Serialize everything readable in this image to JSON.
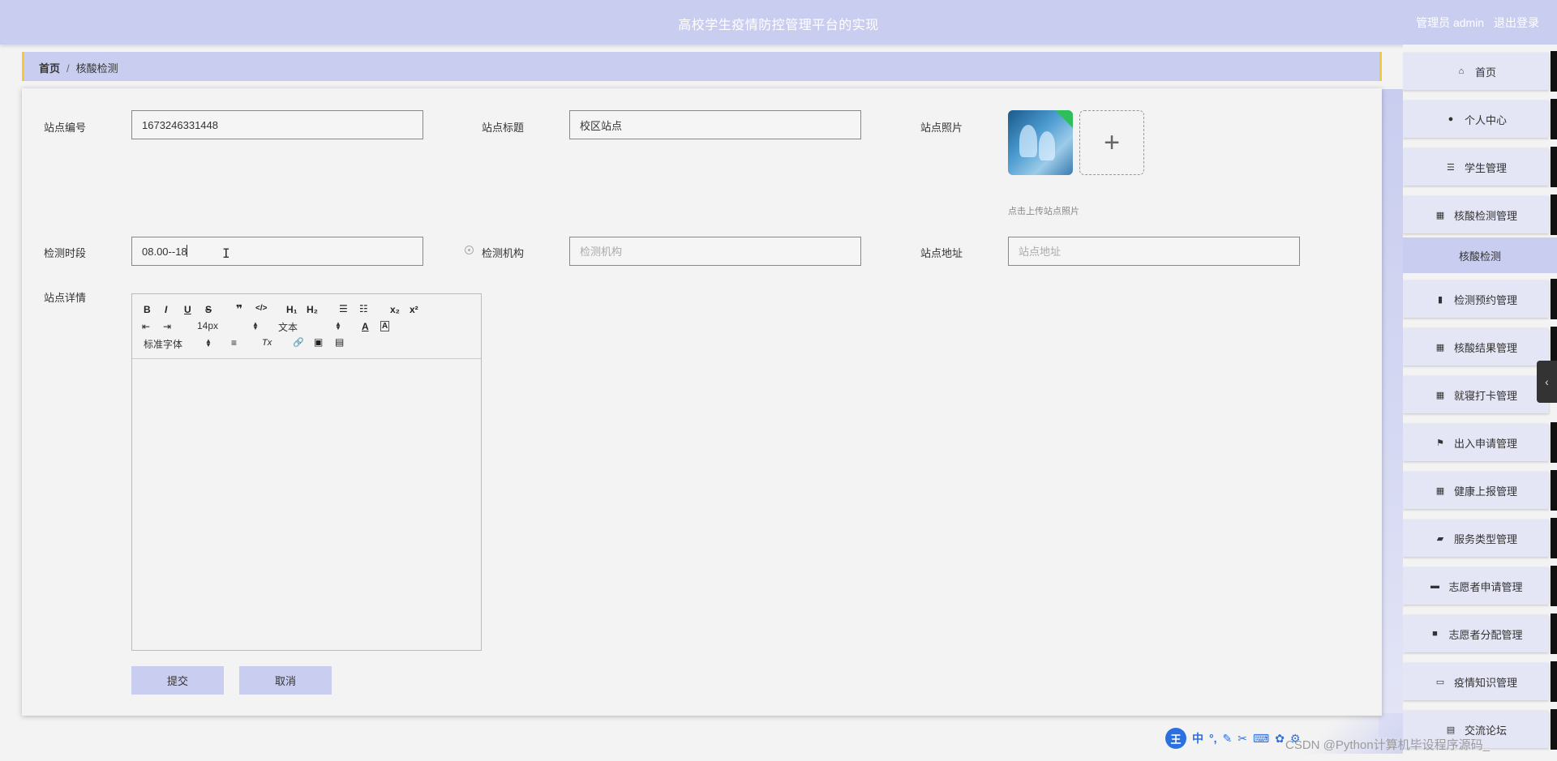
{
  "header": {
    "title": "高校学生疫情防控管理平台的实现",
    "user_label": "管理员 admin",
    "logout_label": "退出登录"
  },
  "breadcrumb": {
    "home": "首页",
    "separator": "/",
    "current": "核酸检测"
  },
  "form": {
    "station_no_label": "站点编号",
    "station_no_value": "1673246331448",
    "station_title_label": "站点标题",
    "station_title_value": "校区站点",
    "station_photo_label": "站点照片",
    "photo_hint": "点击上传站点照片",
    "upload_plus": "+",
    "time_label": "检测时段",
    "time_value": "08.00--18",
    "org_label": "检测机构",
    "org_placeholder": "检测机构",
    "address_label": "站点地址",
    "address_placeholder": "站点地址",
    "detail_label": "站点详情",
    "submit_label": "提交",
    "cancel_label": "取消"
  },
  "editor_toolbar": {
    "bold": "B",
    "italic": "I",
    "underline": "U",
    "strike": "S",
    "quote": "❞",
    "code": "</>",
    "h1": "H₁",
    "h2": "H₂",
    "ordered_list": "☰",
    "bullet_list": "☷",
    "subscript": "x₂",
    "superscript": "x²",
    "indent_out": "⇤",
    "indent_in": "⇥",
    "font_size": "14px",
    "text_type": "文本",
    "font_color": "A",
    "bg_color": "A",
    "font_family": "标准字体",
    "align": "≡",
    "clean": "Tx",
    "link": "🔗",
    "image": "▣",
    "video": "▤"
  },
  "sidebar": {
    "items": [
      {
        "label": "首页",
        "icon": "home-icon"
      },
      {
        "label": "个人中心",
        "icon": "user-icon"
      },
      {
        "label": "学生管理",
        "icon": "list-icon"
      },
      {
        "label": "核酸检测管理",
        "icon": "grid-icon"
      },
      {
        "label": "检测预约管理",
        "icon": "book-icon"
      },
      {
        "label": "核酸结果管理",
        "icon": "grid-icon"
      },
      {
        "label": "就寝打卡管理",
        "icon": "grid-icon"
      },
      {
        "label": "出入申请管理",
        "icon": "flag-icon"
      },
      {
        "label": "健康上报管理",
        "icon": "grid-icon"
      },
      {
        "label": "服务类型管理",
        "icon": "briefcase-icon"
      },
      {
        "label": "志愿者申请管理",
        "icon": "monitor-icon"
      },
      {
        "label": "志愿者分配管理",
        "icon": "chat-icon"
      },
      {
        "label": "疫情知识管理",
        "icon": "laptop-icon"
      },
      {
        "label": "交流论坛",
        "icon": "clipboard-icon"
      }
    ],
    "active_sub": "核酸检测"
  },
  "ime": {
    "logo": "王",
    "mode": "中",
    "punct": "°,",
    "items": [
      "✎",
      "✂",
      "⌨",
      "✿",
      "⚙"
    ]
  },
  "watermark": "CSDN @Python计算机毕设程序源码_",
  "colors": {
    "accent": "#c9cdef",
    "breadcrumb_border": "#f3c93a"
  }
}
